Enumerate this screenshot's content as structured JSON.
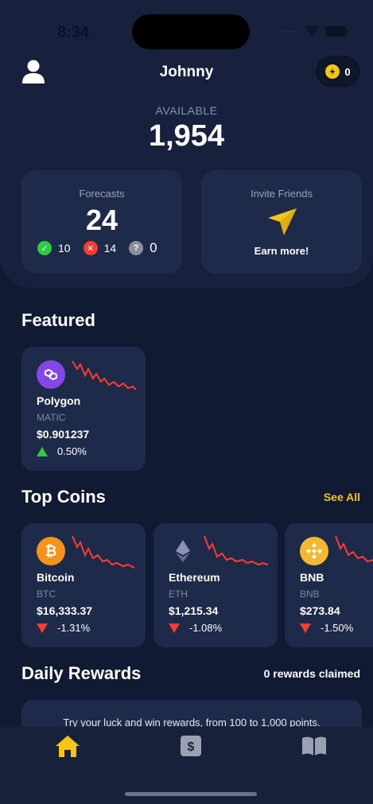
{
  "status_bar": {
    "time": "8:34"
  },
  "header": {
    "username": "Johnny",
    "coins": "0",
    "available_label": "AVAILABLE",
    "available_value": "1,954"
  },
  "forecasts": {
    "label": "Forecasts",
    "value": "24",
    "correct": "10",
    "wrong": "14",
    "pending": "0"
  },
  "invite": {
    "label": "Invite Friends",
    "action": "Earn more!"
  },
  "featured": {
    "title": "Featured",
    "items": [
      {
        "name": "Polygon",
        "symbol": "MATIC",
        "price": "$0.901237",
        "change": "0.50%",
        "direction": "up",
        "logo_color": "#8247e5",
        "icon": "polygon-icon"
      }
    ]
  },
  "top_coins": {
    "title": "Top Coins",
    "see_all": "See All",
    "items": [
      {
        "name": "Bitcoin",
        "symbol": "BTC",
        "price": "$16,333.37",
        "change": "-1.31%",
        "direction": "down",
        "logo_color": "#f7931a",
        "icon": "bitcoin-icon"
      },
      {
        "name": "Ethereum",
        "symbol": "ETH",
        "price": "$1,215.34",
        "change": "-1.08%",
        "direction": "down",
        "logo_color": "#1e2a4a",
        "icon": "ethereum-icon"
      },
      {
        "name": "BNB",
        "symbol": "BNB",
        "price": "$273.84",
        "change": "-1.50%",
        "direction": "down",
        "logo_color": "#f3ba2f",
        "icon": "bnb-icon"
      }
    ]
  },
  "daily_rewards": {
    "title": "Daily Rewards",
    "claimed": "0 rewards claimed",
    "text": "Try your luck and win rewards, from 100 to 1,000 points."
  },
  "tabs": [
    {
      "icon": "home-icon",
      "active": true
    },
    {
      "icon": "dollar-icon",
      "active": false
    },
    {
      "icon": "book-icon",
      "active": false
    }
  ],
  "colors": {
    "accent": "#f5c518",
    "up": "#2ecc40",
    "down": "#ff3b30",
    "background": "#101a33",
    "card": "#1e2a4a"
  }
}
